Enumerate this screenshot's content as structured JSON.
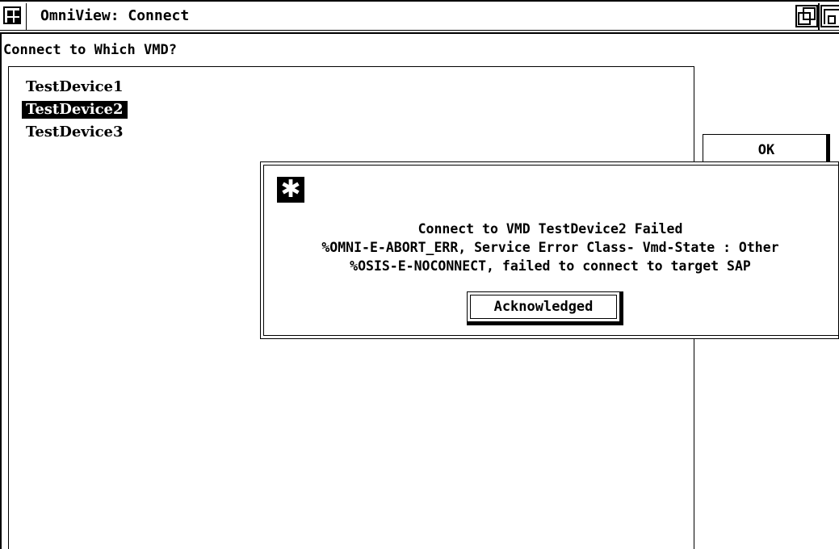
{
  "window": {
    "title": "OmniView: Connect"
  },
  "prompt": {
    "label": "Connect to Which VMD?"
  },
  "vmd_list": {
    "items": [
      {
        "label": "TestDevice1",
        "selected": false
      },
      {
        "label": "TestDevice2",
        "selected": true
      },
      {
        "label": "TestDevice3",
        "selected": false
      }
    ]
  },
  "buttons": {
    "ok_label": "OK"
  },
  "error_dialog": {
    "icon": "asterisk-icon",
    "icon_glyph": "✱",
    "lines": [
      "Connect to VMD TestDevice2 Failed",
      "%OMNI-E-ABORT_ERR, Service Error Class- Vmd-State : Other",
      "%OSIS-E-NOCONNECT, failed to connect to target SAP"
    ],
    "ack_label": "Acknowledged"
  },
  "colors": {
    "foreground": "#000000",
    "background": "#ffffff",
    "selection": "#000000"
  }
}
